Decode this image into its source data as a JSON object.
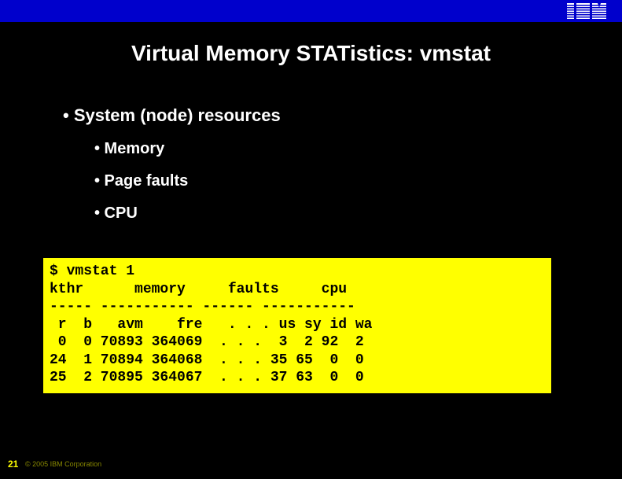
{
  "logo_alt": "IBM",
  "title": "Virtual Memory STATistics: vmstat",
  "bullet1": "• System (node) resources",
  "bullets2": {
    "a": "• Memory",
    "b": "• Page faults",
    "c": "• CPU"
  },
  "terminal": {
    "line0": "$ vmstat 1",
    "line1": "kthr      memory     faults     cpu",
    "line2": "----- ----------- ------ -----------",
    "line3": " r  b   avm    fre   . . . us sy id wa",
    "line4": " 0  0 70893 364069  . . .  3  2 92  2",
    "line5": "24  1 70894 364068  . . . 35 65  0  0",
    "line6": "25  2 70895 364067  . . . 37 63  0  0"
  },
  "pageno": "21",
  "copyright": "© 2005 IBM Corporation"
}
